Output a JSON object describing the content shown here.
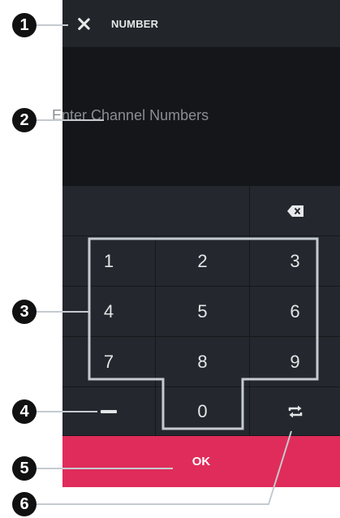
{
  "header": {
    "title": "NUMBER",
    "close_icon": "close-icon"
  },
  "display": {
    "placeholder": "Enter Channel Numbers"
  },
  "keypad": {
    "backspace_icon": "backspace-icon",
    "keys": [
      "1",
      "2",
      "3",
      "4",
      "5",
      "6",
      "7",
      "8",
      "9",
      "0"
    ],
    "dash_icon": "dash-icon",
    "swap_icon": "swap-icon"
  },
  "ok_button": {
    "label": "OK"
  },
  "callouts": [
    "1",
    "2",
    "3",
    "4",
    "5",
    "6"
  ],
  "colors": {
    "accent": "#e02c5a",
    "background": "#1b1e23",
    "display_bg": "#141619",
    "key_bg": "#24282e",
    "outline": "#c4cad0"
  }
}
